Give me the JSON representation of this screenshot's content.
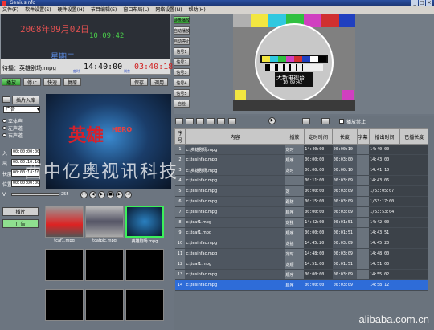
{
  "window": {
    "title": "GeniusInfo"
  },
  "menu": [
    "文件(F)",
    "软件设置(S)",
    "硬件设置(H)",
    "节目编辑(E)",
    "窗口布局(L)",
    "网络设置(N)",
    "帮助(H)"
  ],
  "clock": {
    "date": "2008年09月02日",
    "time": "10:09:42",
    "weekday": "星期二"
  },
  "status": {
    "label": "待播：英雄剧场.mpg",
    "time_label": "定时",
    "time": "14:40:00",
    "remain_label": "剩余",
    "remain": "03:40:18"
  },
  "controls": {
    "play": "播放",
    "stop": "停止",
    "speed": "快速",
    "restart": "复原",
    "save": "保存",
    "open": "调用"
  },
  "sidebar": [
    "硬盘播放",
    "自动播放",
    "自动停止",
    "信号1",
    "信号2",
    "信号3",
    "信号4",
    "信号5",
    "自检"
  ],
  "left": {
    "insert": "插片入库",
    "type_select": "广告",
    "audio": [
      "立体声",
      "左声道",
      "右声道"
    ],
    "in_label": "入",
    "in_value": "00:00:00:00",
    "out_label": "出",
    "out_value": "00:00:10:10",
    "len_label": "长度",
    "len_value": "00:00:10:10",
    "pos_label": "位置",
    "pos_value": "00:00:00:00",
    "volume_label": "V:",
    "volume_value": "255"
  },
  "hero": {
    "title": "英雄",
    "logo": "HERO"
  },
  "testcard": {
    "caption": "大新电视台",
    "time": "10:09:42"
  },
  "watermark": "西中亿奥视讯科技",
  "footer_site": "alibaba.com.cn",
  "tabs": {
    "clip": "插片",
    "ads": "广告"
  },
  "thumbs": [
    "tcaf1.mpg",
    "tcafpic.mpg",
    "英雄剧场.mpg"
  ],
  "table": {
    "columns": [
      "序号",
      "内容",
      "播放",
      "定时时间",
      "长度",
      "字幕",
      "播出时间",
      "已播长度"
    ],
    "rows": [
      {
        "n": "1",
        "name": "c:\\英雄剧场.mpg",
        "mode": "定时",
        "sched": "14:40:00",
        "len": "00:00:10",
        "cap": "",
        "play": "14:40:00",
        "rem": ""
      },
      {
        "n": "2",
        "name": "c:\\tesinfac.mpg",
        "mode": "顺序",
        "sched": "00:00:00",
        "len": "00:03:00",
        "cap": "",
        "play": "14:43:00",
        "rem": ""
      },
      {
        "n": "3",
        "name": "c:\\英雄剧场.mpg",
        "mode": "定时",
        "sched": "00:00:00",
        "len": "00:00:10",
        "cap": "",
        "play": "14:41:10",
        "rem": ""
      },
      {
        "n": "4",
        "name": "c:\\tesinfac.mpg",
        "mode": "",
        "sched": "00:11:00",
        "len": "00:03:09",
        "cap": "",
        "play": "14:43:06",
        "rem": ""
      },
      {
        "n": "5",
        "name": "c:\\tesinfac.mpg",
        "mode": "定",
        "sched": "00:00:00",
        "len": "00:03:09",
        "cap": "",
        "play": "1/53:05:07",
        "rem": ""
      },
      {
        "n": "6",
        "name": "c:\\tesinfac.mpg",
        "mode": "跟随",
        "sched": "00:15:00",
        "len": "00:03:09",
        "cap": "",
        "play": "1/53:17:00",
        "rem": ""
      },
      {
        "n": "7",
        "name": "c:\\tesinfac.mpg",
        "mode": "顺序",
        "sched": "00:00:00",
        "len": "00:03:09",
        "cap": "",
        "play": "1/53:53:04",
        "rem": ""
      },
      {
        "n": "8",
        "name": "c:\\tcaf1.mpg",
        "mode": "定独",
        "sched": "14:42:00",
        "len": "00:01:51",
        "cap": "",
        "play": "14:42:00",
        "rem": ""
      },
      {
        "n": "9",
        "name": "c:\\tcaf1.mpg",
        "mode": "顺序",
        "sched": "00:00:00",
        "len": "00:01:51",
        "cap": "",
        "play": "14:43:51",
        "rem": ""
      },
      {
        "n": "10",
        "name": "c:\\tesinfac.mpg",
        "mode": "定插",
        "sched": "14:45:20",
        "len": "00:03:09",
        "cap": "",
        "play": "14:45:20",
        "rem": ""
      },
      {
        "n": "11",
        "name": "c:\\tesinfac.mpg",
        "mode": "定时",
        "sched": "14:48:00",
        "len": "00:03:09",
        "cap": "",
        "play": "14:48:00",
        "rem": ""
      },
      {
        "n": "12",
        "name": "c:\\tcaf1.mpg",
        "mode": "定顺",
        "sched": "14:51:00",
        "len": "00:01:51",
        "cap": "",
        "play": "14:51:00",
        "rem": ""
      },
      {
        "n": "13",
        "name": "c:\\tesinfac.mpg",
        "mode": "顺序",
        "sched": "00:00:00",
        "len": "00:03:09",
        "cap": "",
        "play": "14:55:02",
        "rem": ""
      },
      {
        "n": "14",
        "name": "c:\\tesinfac.mpg",
        "mode": "顺序",
        "sched": "00:00:00",
        "len": "00:03:09",
        "cap": "",
        "play": "14:58:12",
        "rem": ""
      }
    ]
  },
  "toolbar2": {
    "no_play": "播放禁止"
  }
}
